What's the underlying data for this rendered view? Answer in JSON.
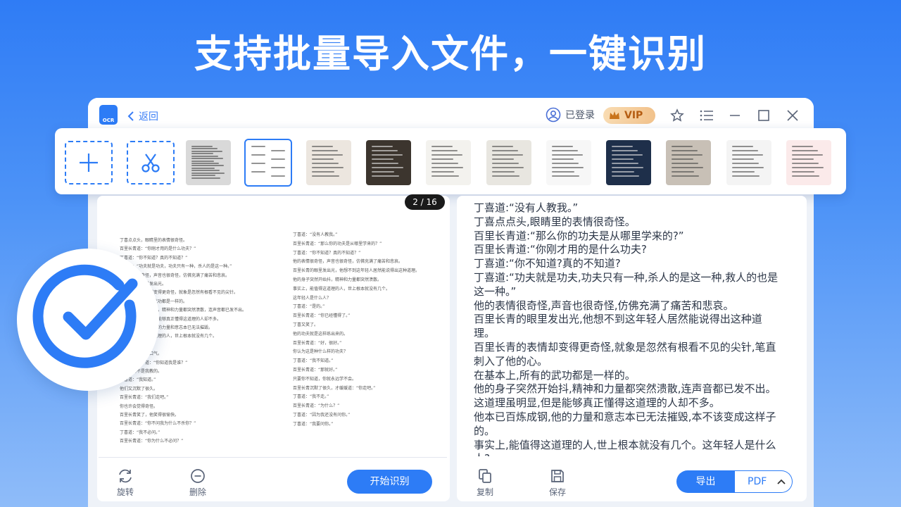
{
  "headline": "支持批量导入文件，一键识别",
  "titlebar": {
    "logo_text": "OCR",
    "back_label": "返回",
    "login_status": "已登录",
    "vip_label": "VIP"
  },
  "thumbnails": {
    "count": 11,
    "selected_index": 1
  },
  "left_panel": {
    "page_counter": "2 / 16",
    "rotate_label": "旋转",
    "delete_label": "删除",
    "start_button": "开始识别"
  },
  "doc_page": {
    "col1": [
      "丁喜点点头，眼睛里的表情很奇怪。",
      "百里长青道：“你刚才用的是什么功夫？”",
      "丁喜道：“你不知道？真的不知道？”",
      "丁喜道：“功夫就是功夫，功夫只有一种，杀人的是这一种。”",
      "他的表情很奇怪，声音也很奇怪，仿佛充满了痛苦和悲哀。",
      "百里长青的眼里发出光。",
      "百里长青的表情却变得更奇怪，就象是忽然有根看不见的尖针。",
      "在基本上，所有的武功都是一样的。",
      "他的身子突然开始抖，精神和力量都突然溃散，连声音都已发不出。",
      "这道理虽明显，但是能够真正懂得这道理的人却不多。",
      "他本已百炼成钢，他的力量和意志本已无法摧毁。",
      "事实上，能值得这道理的人，世上根本就没有几个。",
      "丁喜道：“是的。”",
      "百里长青又叹了口气。",
      "他又笑了笑，道：“你知道我是谁？”",
      "这种武功不是我教的。",
      "丁喜道：“我知道。”",
      "他们又沉默了很久。",
      "百里长青道：“我们走吧。”",
      "你也许会觉得奇怪。",
      "百里长青笑了，他笑得很愉快。",
      "百里长青道：“你不问我为什么不杀你？”",
      "丁喜道：“我不必问。”",
      "百里长青道：“你为什么不必问？”"
    ],
    "col2": [
      "丁喜道：“没有人教我。”",
      "百里长青道：“那么你的功夫是从哪里学来的？”",
      "丁喜道：“你不知道？真的不知道？”",
      "他的表情很奇怪，声音也很奇怪，仿佛充满了痛苦和悲哀。",
      "百里长青的眼里发出光，他想不到这年轻人居然能说得出这种道理。",
      "他的身子突然开始抖，精神和力量都突然溃散。",
      "事实上，能值得这道理的人，世上根本就没有几个。",
      "这年轻人是什么人？",
      "丁喜道：“是的。”",
      "百里长青道：“你已经懂得了。”",
      "丁喜又笑了。",
      "他的功夫就是这样练出来的。",
      "百里长青道：“好，很好。”",
      "你认为这是种什么样的功夫？",
      "丁喜道：“我不知道。”",
      "百里长青道：“那就好。”",
      "只要你不知道，你就永远学不会。",
      "百里长青沉默了很久，才缓缓道：“你走吧。”",
      "丁喜道：“我不走。”",
      "百里长青道：“为什么？”",
      "丁喜道：“因为我还没有问你。”",
      "丁喜道：“我要问你。”"
    ]
  },
  "result_text": [
    "丁喜道:“没有人教我。”",
    "丁喜点点头,眼睛里的表情很奇怪。",
    "百里长青道:“那么你的功夫是从哪里学来的?”",
    "百里长青道:“你刚才用的是什么功夫?",
    "丁喜道:“你不知道?真的不知道?",
    "丁喜道:“功夫就是功夫,功夫只有一种,杀人的是这一种,救人的也是",
    "这一种。”",
    "他的表情很奇怪,声音也很奇怪,仿佛充满了痛苦和悲哀。",
    "百里长青的眼里发出光,他想不到这年轻人居然能说得出这种道",
    "理。",
    "百里长青的表情却变得更奇怪,就象是忽然有根看不见的尖针,笔直",
    "刺入了他的心。",
    "在基本上,所有的武功都是一样的。",
    "他的身子突然开始抖,精神和力量都突然溃散,连声音都已发不出。",
    "这道理虽明显,但是能够真正懂得这道理的人却不多。",
    "他本已百炼成钢,他的力量和意志本已无法摧毁,本不该变成这样子",
    "的。",
    "事实上,能值得这道理的人,世上根本就没有几个。这年轻人是什么",
    "人?"
  ],
  "right_panel": {
    "copy_label": "复制",
    "save_label": "保存",
    "export_button": "导出",
    "format_value": "PDF"
  },
  "colors": {
    "accent": "#2d7cf6",
    "background_top": "#2f7cf5",
    "vip_gold": "#f2c28b"
  }
}
